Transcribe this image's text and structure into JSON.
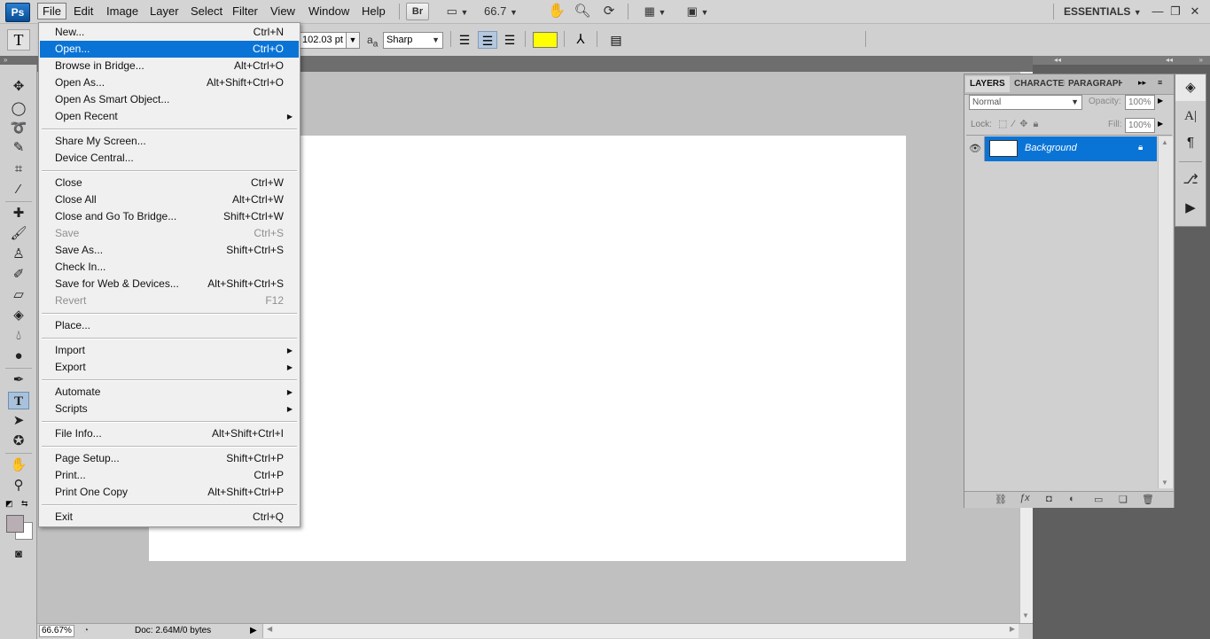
{
  "app": {
    "logo": "Ps"
  },
  "menubar": {
    "items": [
      "File",
      "Edit",
      "Image",
      "Layer",
      "Select",
      "Filter",
      "View",
      "Window",
      "Help"
    ],
    "bridge": "Br",
    "zoom": "66.7",
    "workspace": "ESSENTIALS",
    "window_controls": [
      "—",
      "❐",
      "✕"
    ]
  },
  "options": {
    "tool_glyph": "T",
    "font_size": "102.03 pt",
    "aa_label": "a",
    "aa_label_sub": "a",
    "antialias": "Sharp",
    "text_color": "#ffff00"
  },
  "file_menu": {
    "groups": [
      [
        {
          "label": "New...",
          "shortcut": "Ctrl+N"
        },
        {
          "label": "Open...",
          "shortcut": "Ctrl+O",
          "highlight": true
        },
        {
          "label": "Browse in Bridge...",
          "shortcut": "Alt+Ctrl+O"
        },
        {
          "label": "Open As...",
          "shortcut": "Alt+Shift+Ctrl+O"
        },
        {
          "label": "Open As Smart Object...",
          "shortcut": ""
        },
        {
          "label": "Open Recent",
          "shortcut": "",
          "submenu": true
        }
      ],
      [
        {
          "label": "Share My Screen...",
          "shortcut": ""
        },
        {
          "label": "Device Central...",
          "shortcut": ""
        }
      ],
      [
        {
          "label": "Close",
          "shortcut": "Ctrl+W"
        },
        {
          "label": "Close All",
          "shortcut": "Alt+Ctrl+W"
        },
        {
          "label": "Close and Go To Bridge...",
          "shortcut": "Shift+Ctrl+W"
        },
        {
          "label": "Save",
          "shortcut": "Ctrl+S",
          "disabled": true
        },
        {
          "label": "Save As...",
          "shortcut": "Shift+Ctrl+S"
        },
        {
          "label": "Check In...",
          "shortcut": ""
        },
        {
          "label": "Save for Web & Devices...",
          "shortcut": "Alt+Shift+Ctrl+S"
        },
        {
          "label": "Revert",
          "shortcut": "F12",
          "disabled": true
        }
      ],
      [
        {
          "label": "Place...",
          "shortcut": ""
        }
      ],
      [
        {
          "label": "Import",
          "shortcut": "",
          "submenu": true
        },
        {
          "label": "Export",
          "shortcut": "",
          "submenu": true
        }
      ],
      [
        {
          "label": "Automate",
          "shortcut": "",
          "submenu": true
        },
        {
          "label": "Scripts",
          "shortcut": "",
          "submenu": true
        }
      ],
      [
        {
          "label": "File Info...",
          "shortcut": "Alt+Shift+Ctrl+I"
        }
      ],
      [
        {
          "label": "Page Setup...",
          "shortcut": "Shift+Ctrl+P"
        },
        {
          "label": "Print...",
          "shortcut": "Ctrl+P"
        },
        {
          "label": "Print One Copy",
          "shortcut": "Alt+Shift+Ctrl+P"
        }
      ],
      [
        {
          "label": "Exit",
          "shortcut": "Ctrl+Q"
        }
      ]
    ]
  },
  "layers_panel": {
    "tabs": [
      "LAYERS",
      "CHARACTER",
      "PARAGRAPH"
    ],
    "blend_mode": "Normal",
    "opacity_label": "Opacity:",
    "opacity": "100%",
    "lock_label": "Lock:",
    "fill_label": "Fill:",
    "fill": "100%",
    "layer_name": "Background"
  },
  "status": {
    "zoom": "66.67%",
    "doc": "Doc: 2.64M/0 bytes"
  },
  "colors": {
    "highlight": "#0a74d6",
    "foreground_swatch": "#b9aeb3",
    "background_swatch": "#ffffff"
  }
}
